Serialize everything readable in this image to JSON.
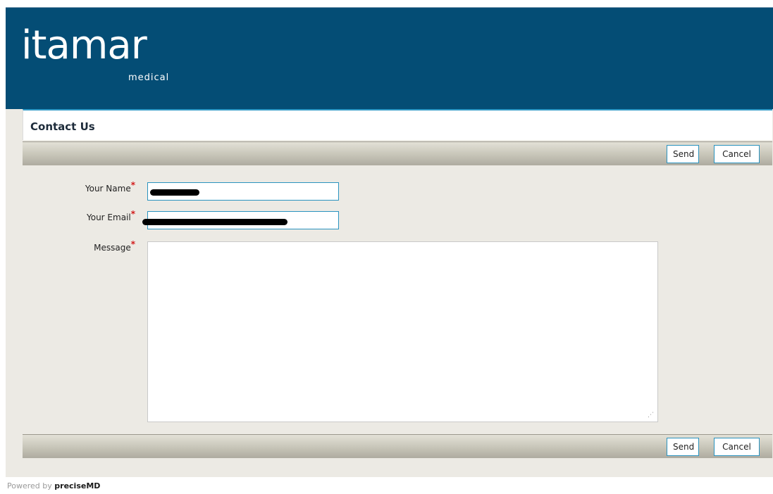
{
  "brand": {
    "logo_word": "itamar",
    "logo_sub": "medical",
    "banner_color": "#044d75"
  },
  "page": {
    "title": "Contact Us"
  },
  "toolbar_top": {
    "send_label": "Send",
    "cancel_label": "Cancel"
  },
  "toolbar_bottom": {
    "send_label": "Send",
    "cancel_label": "Cancel"
  },
  "form": {
    "name_label": "Your Name",
    "email_label": "Your Email",
    "message_label": "Message",
    "required_marker": "*",
    "name_value": "",
    "email_value": "",
    "message_value": ""
  },
  "footer": {
    "powered_by": "Powered by",
    "product": "preciseMD"
  }
}
